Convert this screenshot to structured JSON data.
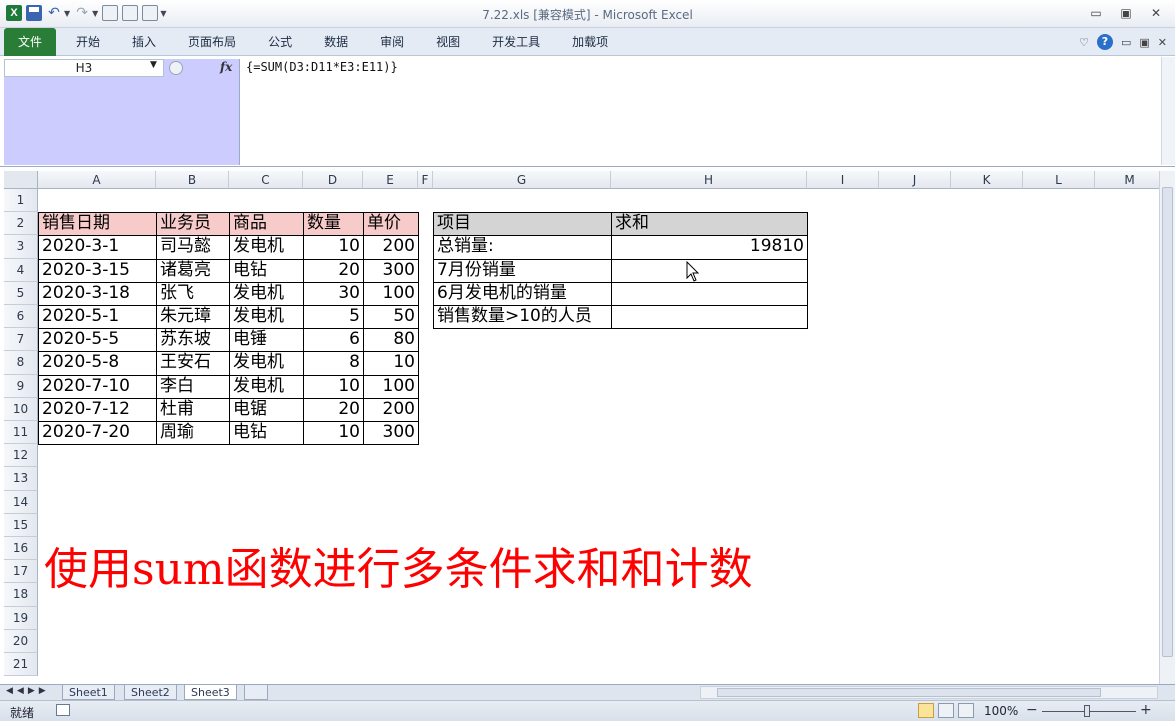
{
  "titlebar": {
    "title": "7.22.xls  [兼容模式]  -  Microsoft Excel",
    "excel_glyph": "X",
    "undo_glyph": "↶",
    "redo_glyph": "↷",
    "minimize_glyph": "▭",
    "restore_glyph": "▣",
    "close_glyph": "✕"
  },
  "ribbon": {
    "tabs": [
      "文件",
      "开始",
      "插入",
      "页面布局",
      "公式",
      "数据",
      "审阅",
      "视图",
      "开发工具",
      "加载项"
    ],
    "help_glyph": "?"
  },
  "formula_bar": {
    "name_box": "H3",
    "fx_label": "fx",
    "formula": "{=SUM(D3:D11*E3:E11)}"
  },
  "columns": [
    "A",
    "B",
    "C",
    "D",
    "E",
    "F",
    "G",
    "H",
    "I",
    "J",
    "K",
    "L",
    "M"
  ],
  "rows": [
    "1",
    "2",
    "3",
    "4",
    "5",
    "6",
    "7",
    "8",
    "9",
    "10",
    "11",
    "12",
    "13",
    "14",
    "15",
    "16",
    "17",
    "18",
    "19",
    "20",
    "21"
  ],
  "sales_table": {
    "headers": [
      "销售日期",
      "业务员",
      "商品",
      "数量",
      "单价"
    ],
    "rows": [
      [
        "2020-3-1",
        "司马懿",
        "发电机",
        "10",
        "200"
      ],
      [
        "2020-3-15",
        "诸葛亮",
        "电钻",
        "20",
        "300"
      ],
      [
        "2020-3-18",
        "张飞",
        "发电机",
        "30",
        "100"
      ],
      [
        "2020-5-1",
        "朱元璋",
        "发电机",
        "5",
        "50"
      ],
      [
        "2020-5-5",
        "苏东坡",
        "电锤",
        "6",
        "80"
      ],
      [
        "2020-5-8",
        "王安石",
        "发电机",
        "8",
        "10"
      ],
      [
        "2020-7-10",
        "李白",
        "发电机",
        "10",
        "100"
      ],
      [
        "2020-7-12",
        "杜甫",
        "电锯",
        "20",
        "200"
      ],
      [
        "2020-7-20",
        "周瑜",
        "电钻",
        "10",
        "300"
      ]
    ]
  },
  "summary_table": {
    "headers": [
      "项目",
      "求和"
    ],
    "rows": [
      [
        "总销量:",
        "19810"
      ],
      [
        "7月份销量",
        ""
      ],
      [
        "6月发电机的销量",
        ""
      ],
      [
        "销售数量>10的人员",
        ""
      ]
    ]
  },
  "overlay_text": "使用sum函数进行多条件求和和计数",
  "sheets": [
    "Sheet1",
    "Sheet2",
    "Sheet3"
  ],
  "active_sheet": "Sheet3",
  "status": {
    "ready": "就绪",
    "zoom": "100%",
    "zoom_minus": "−",
    "zoom_plus": "+"
  }
}
